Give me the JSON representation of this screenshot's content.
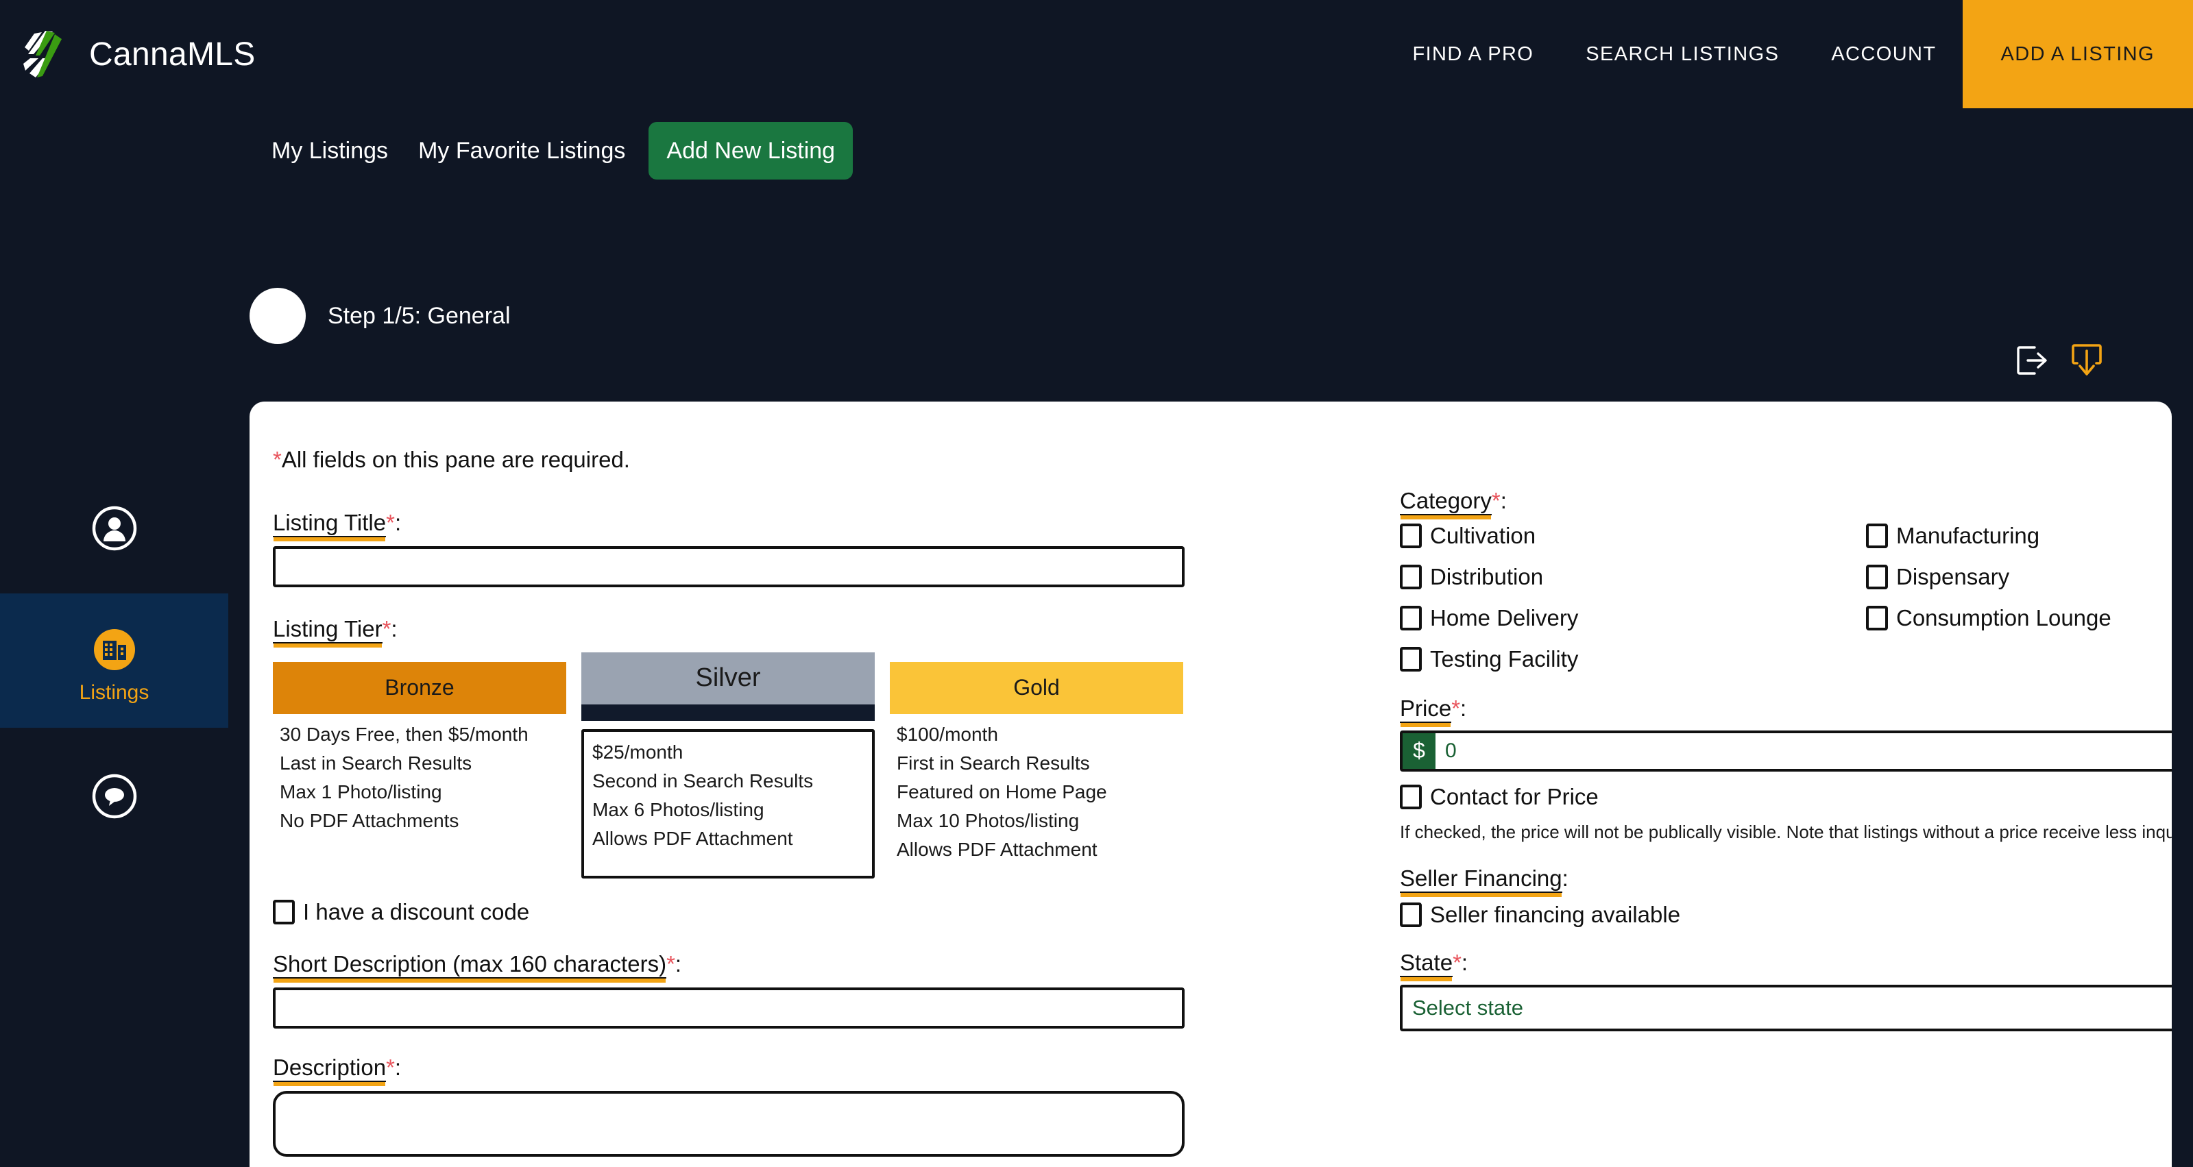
{
  "brand": {
    "name": "CannaMLS",
    "logo_icon": "cannamls-logo-icon"
  },
  "topnav": {
    "items": [
      {
        "label": "FIND A PRO",
        "cta": false
      },
      {
        "label": "SEARCH LISTINGS",
        "cta": false
      },
      {
        "label": "ACCOUNT",
        "cta": false
      },
      {
        "label": "ADD A LISTING",
        "cta": true
      }
    ],
    "cta_color": "#f3a414"
  },
  "subnav": {
    "links": [
      {
        "label": "My Listings"
      },
      {
        "label": "My Favorite Listings"
      }
    ],
    "button": {
      "label": "Add New Listing",
      "color": "#1a7740"
    }
  },
  "step": {
    "label": "Step 1/5: General",
    "current": 1,
    "total": 5,
    "name": "General"
  },
  "card_actions": [
    {
      "icon": "exit-arrow-icon",
      "color": "#ffffff"
    },
    {
      "icon": "download-save-icon",
      "color": "#f3a414"
    }
  ],
  "sidebar": {
    "items": [
      {
        "icon": "profile-icon",
        "label": "",
        "active": false
      },
      {
        "icon": "listings-building-icon",
        "label": "Listings",
        "active": true
      },
      {
        "icon": "chat-bubble-icon",
        "label": "",
        "active": false
      }
    ],
    "active_color": "#f3a414",
    "active_bg": "#0b2a4d"
  },
  "form": {
    "required_note": "All fields on this pane are required.",
    "required_marker": "*",
    "listing_title": {
      "label": "Listing Title",
      "required": true,
      "value": "",
      "placeholder": ""
    },
    "listing_tier": {
      "label": "Listing Tier",
      "required": true,
      "selected": "Silver",
      "tiers": [
        {
          "name": "Bronze",
          "color": "#dd8409",
          "features": [
            "30 Days Free, then $5/month",
            "Last in Search Results",
            "Max 1 Photo/listing",
            "No PDF Attachments"
          ]
        },
        {
          "name": "Silver",
          "color": "#9aa3b1",
          "features": [
            "$25/month",
            "Second in Search Results",
            "Max 6 Photos/listing",
            "Allows PDF Attachment"
          ]
        },
        {
          "name": "Gold",
          "color": "#fac438",
          "features": [
            "$100/month",
            "First in Search Results",
            "Featured on Home Page",
            "Max 10 Photos/listing",
            "Allows PDF Attachment"
          ]
        }
      ]
    },
    "discount_code": {
      "label": "I have a discount code",
      "checked": false
    },
    "short_description": {
      "label": "Short Description (max 160 characters)",
      "required": true,
      "value": "",
      "placeholder": ""
    },
    "description": {
      "label": "Description",
      "required": true,
      "value": "",
      "placeholder": ""
    },
    "category": {
      "label": "Category",
      "required": true,
      "options": [
        {
          "label": "Cultivation",
          "checked": false
        },
        {
          "label": "Manufacturing",
          "checked": false
        },
        {
          "label": "Distribution",
          "checked": false
        },
        {
          "label": "Dispensary",
          "checked": false
        },
        {
          "label": "Home Delivery",
          "checked": false
        },
        {
          "label": "Consumption Lounge",
          "checked": false
        },
        {
          "label": "Testing Facility",
          "checked": false
        }
      ]
    },
    "price": {
      "label": "Price",
      "required": true,
      "currency_symbol": "$",
      "value": "",
      "placeholder": "0",
      "prefix_bg": "#1a6134",
      "contact_for_price": {
        "label": "Contact for Price",
        "checked": false
      },
      "helper": "If checked, the price will not be publically visible. Note that listings without a price receive less inquiries."
    },
    "seller_financing": {
      "label": "Seller Financing",
      "required": false,
      "option": {
        "label": "Seller financing available",
        "checked": false
      }
    },
    "state": {
      "label": "State",
      "required": true,
      "placeholder": "Select state",
      "value": ""
    }
  }
}
